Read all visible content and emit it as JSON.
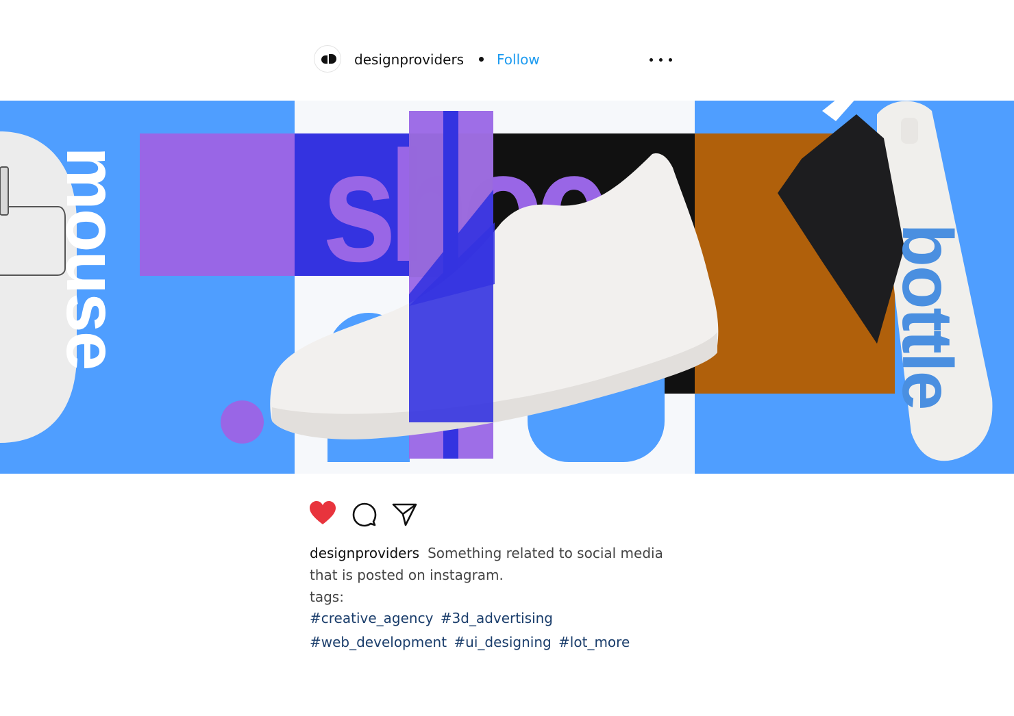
{
  "post": {
    "username": "designproviders",
    "follow_label": "Follow"
  },
  "banner": {
    "word_left": "mouse",
    "word_center": "shoe",
    "word_right": "bottle",
    "colors": {
      "blue": "#4f9eff",
      "purple": "#9966e6",
      "indigo": "#3433e0",
      "orange": "#b0600b",
      "black": "#111111",
      "green": "#5b8c1e",
      "light": "#f6f8fb"
    }
  },
  "actions": {
    "like_icon": "heart-icon",
    "comment_icon": "comment-icon",
    "share_icon": "send-icon",
    "like_color": "#e8343d"
  },
  "caption": {
    "username": "designproviders",
    "text_line1": "Something related to social media",
    "text_line2": "that is posted on instagram.",
    "tags_label": "tags:",
    "tags_line1": [
      "#creative_agency",
      "#3d_advertising"
    ],
    "tags_line2": [
      "#web_development",
      "#ui_designing",
      "#lot_more"
    ]
  }
}
